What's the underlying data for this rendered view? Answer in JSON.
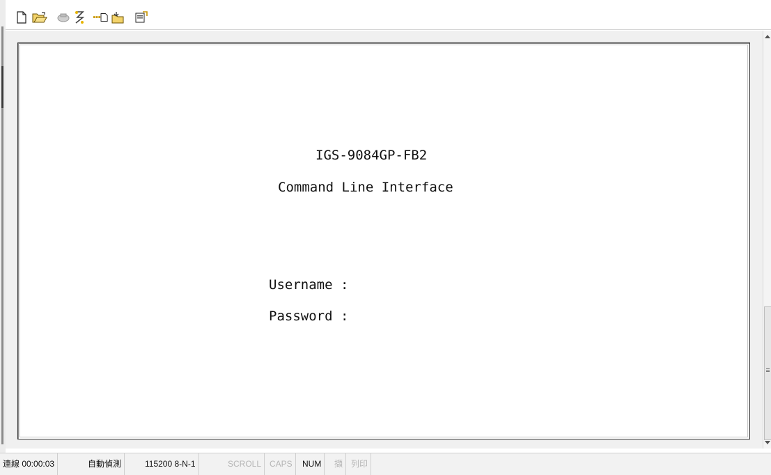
{
  "toolbar": {
    "icons": [
      "new-icon",
      "open-icon",
      "disconnect-icon",
      "connect-icon",
      "send-icon",
      "receive-icon",
      "properties-icon"
    ]
  },
  "terminal": {
    "device_model": "IGS-9084GP-FB2",
    "subtitle": "Command Line Interface",
    "username_prompt": "Username :",
    "password_prompt": "Password :"
  },
  "statusbar": {
    "connection": "連線 00:00:03",
    "detect": "自動偵測",
    "serial": "115200 8-N-1",
    "scroll": "SCROLL",
    "caps": "CAPS",
    "num": "NUM",
    "capture": "擷",
    "print": "列印"
  }
}
